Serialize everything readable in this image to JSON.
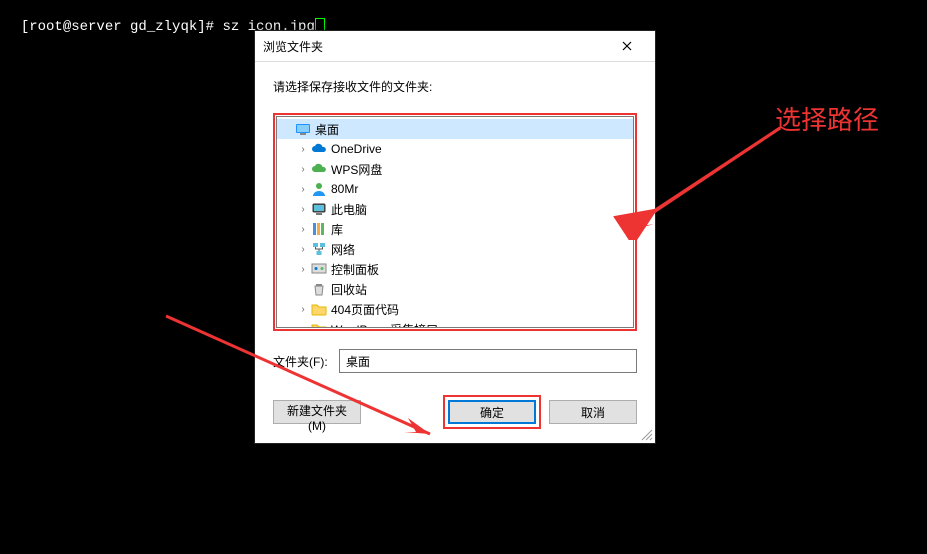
{
  "terminal": {
    "line": "[root@server gd_zlyqk]# sz icon.jpg"
  },
  "dialog": {
    "title": "浏览文件夹",
    "prompt": "请选择保存接收文件的文件夹:",
    "folder_label": "文件夹(F):",
    "folder_value": "桌面",
    "btn_new": "新建文件夹(M)",
    "btn_ok": "确定",
    "btn_cancel": "取消"
  },
  "tree": {
    "items": [
      {
        "indent": 0,
        "expander": "",
        "icon": "desktop",
        "label": "桌面",
        "selected": true
      },
      {
        "indent": 1,
        "expander": "›",
        "icon": "onedrive",
        "label": "OneDrive"
      },
      {
        "indent": 1,
        "expander": "›",
        "icon": "wps",
        "label": "WPS网盘"
      },
      {
        "indent": 1,
        "expander": "›",
        "icon": "user",
        "label": "80Mr"
      },
      {
        "indent": 1,
        "expander": "›",
        "icon": "pc",
        "label": "此电脑"
      },
      {
        "indent": 1,
        "expander": "›",
        "icon": "library",
        "label": "库"
      },
      {
        "indent": 1,
        "expander": "›",
        "icon": "network",
        "label": "网络"
      },
      {
        "indent": 1,
        "expander": "›",
        "icon": "control",
        "label": "控制面板"
      },
      {
        "indent": 1,
        "expander": "",
        "icon": "recycle",
        "label": "回收站"
      },
      {
        "indent": 1,
        "expander": "›",
        "icon": "folder",
        "label": "404页面代码"
      },
      {
        "indent": 1,
        "expander": "›",
        "icon": "folder",
        "label": "WordPress采集接口"
      }
    ]
  },
  "annotation": {
    "arrow1_label": "选择路径"
  }
}
